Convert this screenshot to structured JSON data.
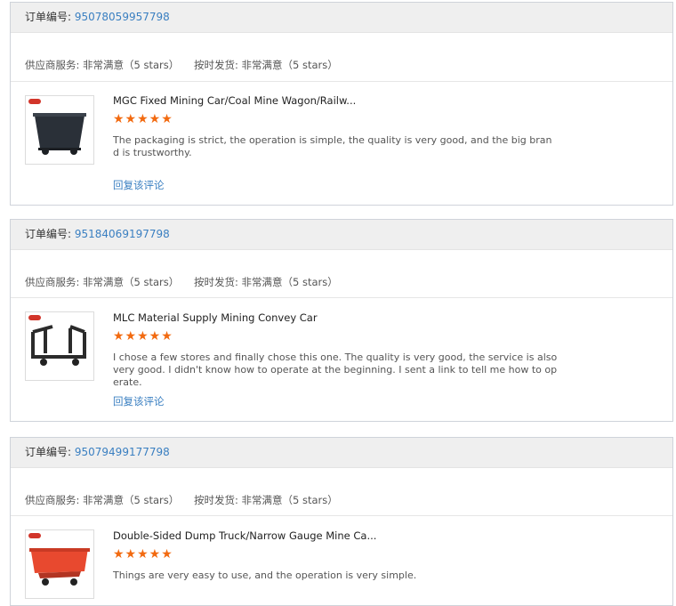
{
  "order_label": "订单编号:",
  "reply_label": "回复该评论",
  "stars": "★★★★★",
  "rating_labels": {
    "supplier": "供应商服务: 非常满意（5 stars）",
    "shipping": "按时发货: 非常满意（5 stars）"
  },
  "colors": {
    "accent": "#3a7fc1",
    "star": "#f26a10",
    "header_bg": "#efefef"
  },
  "reviews": [
    {
      "order_no": "95078059957798",
      "title": "MGC Fixed Mining Car/Coal Mine Wagon/Railw...",
      "text": "The packaging is strict, the operation is simple, the quality is very good, and the big brand is trustworthy.",
      "rating": 5
    },
    {
      "order_no": "95184069197798",
      "title": "MLC Material Supply Mining Convey Car",
      "text": "I chose a few stores and finally chose this one. The quality is very good, the service is also very good. I didn't know how to operate at the beginning. I sent a link to tell me how to operate.",
      "rating": 5
    },
    {
      "order_no": "95079499177798",
      "title": "Double-Sided Dump Truck/Narrow Gauge Mine Ca...",
      "text": "Things are very easy to use, and the operation is very simple.",
      "rating": 5
    }
  ]
}
